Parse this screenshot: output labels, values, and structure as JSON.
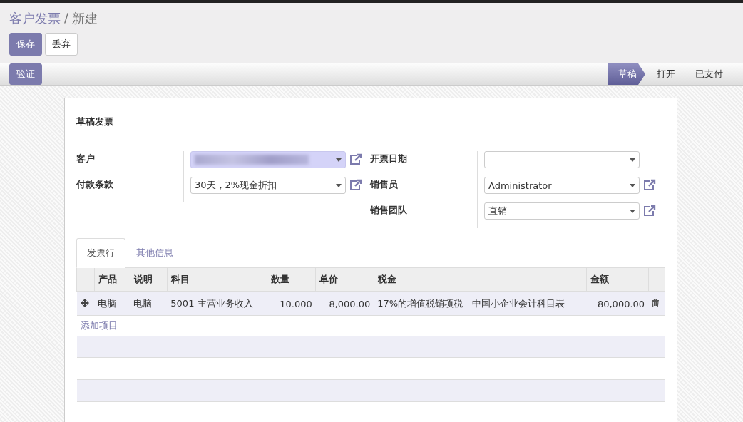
{
  "breadcrumb": {
    "parent": "客户发票",
    "separator": "/",
    "current": "新建"
  },
  "buttons": [
    {
      "label": "保存",
      "kind": "primary"
    },
    {
      "label": "丢弃",
      "kind": "default"
    }
  ],
  "actions": [
    {
      "label": "验证"
    }
  ],
  "statusbar": [
    {
      "label": "草稿",
      "selected": true
    },
    {
      "label": "打开",
      "selected": false
    },
    {
      "label": "已支付",
      "selected": false
    }
  ],
  "sheet_title": "草稿发票",
  "left_fields": [
    {
      "label": "客户",
      "blurred": true,
      "link": true
    },
    {
      "label": "付款条款",
      "value": "30天，2%现金折扣",
      "blurred": false,
      "link": true
    }
  ],
  "right_fields": [
    {
      "label": "开票日期",
      "link": false
    },
    {
      "label": "销售员",
      "value": "Administrator",
      "link": true
    },
    {
      "label": "销售团队",
      "value": "直销",
      "link": true
    }
  ],
  "tabs": [
    {
      "label": "发票行",
      "selected": true
    },
    {
      "label": "其他信息",
      "selected": false
    }
  ],
  "table": {
    "columns": [
      "产品",
      "说明",
      "科目",
      "数量",
      "单价",
      "税金",
      "金额"
    ],
    "rows": [
      {
        "cells": [
          "电脑",
          "电脑",
          "5001 主营业务收入",
          "10.000",
          "8,000.00",
          "17%的增值税销项税 - 中国小企业会计科目表",
          "80,000.00"
        ]
      }
    ],
    "add_link": "添加项目"
  }
}
